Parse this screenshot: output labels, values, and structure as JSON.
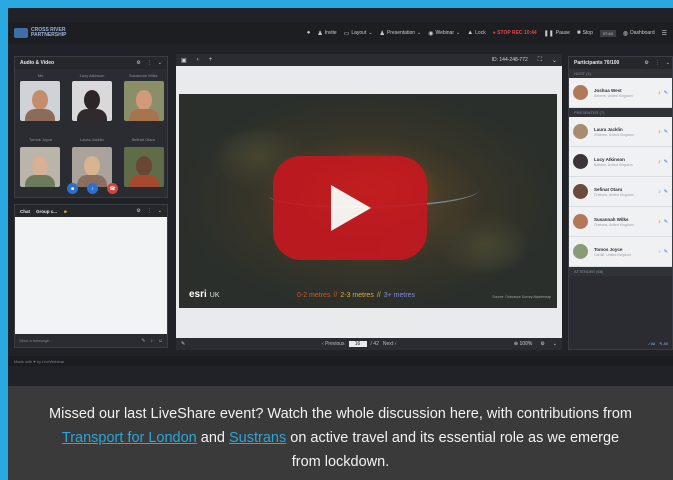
{
  "colors": {
    "page_bg": "#29a9df",
    "card_bg": "#3a3a3a",
    "link": "#28a7d8",
    "youtube_red": "#c4181f"
  },
  "topbar": {
    "brand": "CROSS RIVER PARTNERSHIP",
    "items": [
      {
        "icon": "user-icon",
        "label": "Invite"
      },
      {
        "icon": "layout-icon",
        "label": "Layout"
      },
      {
        "icon": "presentation-icon",
        "label": "Presentation"
      },
      {
        "icon": "webinar-icon",
        "label": "Webinar"
      },
      {
        "icon": "lock-icon",
        "label": "Lock"
      }
    ],
    "rec": "STOP REC 10:44",
    "pause": "Pause",
    "stop": "Stop",
    "time": "07:44",
    "dashboard": "Dashboard"
  },
  "av_panel": {
    "title": "Audio & Video",
    "names": [
      "Me",
      "Lucy Atkinson",
      "Susannah Wilks",
      "Tomos Joyce",
      "Laura Jacklin",
      "Sefinat Otaru"
    ]
  },
  "chat": {
    "tabs": [
      "Chat",
      "Group c..."
    ],
    "placeholder": "Send a message..."
  },
  "stage": {
    "meeting_id": "ID: 144-248-772",
    "esri": "esri",
    "esri_sub": "UK",
    "legend": [
      "0-2 metres",
      "//",
      "2-3 metres",
      "//",
      "3+ metres"
    ],
    "credit": "Source: Ordnance Survey Mastermap",
    "prev": "Previous",
    "page": "16",
    "total": "/ 42",
    "next": "Next",
    "zoom": "100%"
  },
  "participants": {
    "title": "Participants 70/100",
    "host_label": "HOST (1)",
    "presenter_label": "PRESENTER (7)",
    "attendee_label": "ATTENDEE (66)",
    "host": [
      {
        "name": "Joshua West",
        "loc": "Sevens, United Kingdom",
        "color": "#b07a5a"
      }
    ],
    "presenters": [
      {
        "name": "Laura Jacklin",
        "loc": "Chelsea, United Kingdom",
        "color": "#a98b6e"
      },
      {
        "name": "Lucy Atkinson",
        "loc": "Balham, United Kingdom",
        "color": "#3b3437"
      },
      {
        "name": "Sefinat Otaru",
        "loc": "Chelsea, United Kingdom",
        "color": "#6a4a3a"
      },
      {
        "name": "Susannah Wilks",
        "loc": "Chelsea, United Kingdom",
        "color": "#b3775a"
      },
      {
        "name": "Tomos Joyce",
        "loc": "Cardiff, United Kingdom",
        "color": "#8a9b7a"
      }
    ],
    "bottom": [
      "All",
      "All"
    ]
  },
  "footer_strip": "Made with ♥ by LiveWebinar",
  "caption": {
    "before": "Missed our last LiveShare event? Watch the whole discussion here, with contributions from ",
    "link1": "Transport for London",
    "middle": " and ",
    "link2": "Sustrans",
    "after": " on active travel and its essential role as we emerge from lockdown."
  }
}
